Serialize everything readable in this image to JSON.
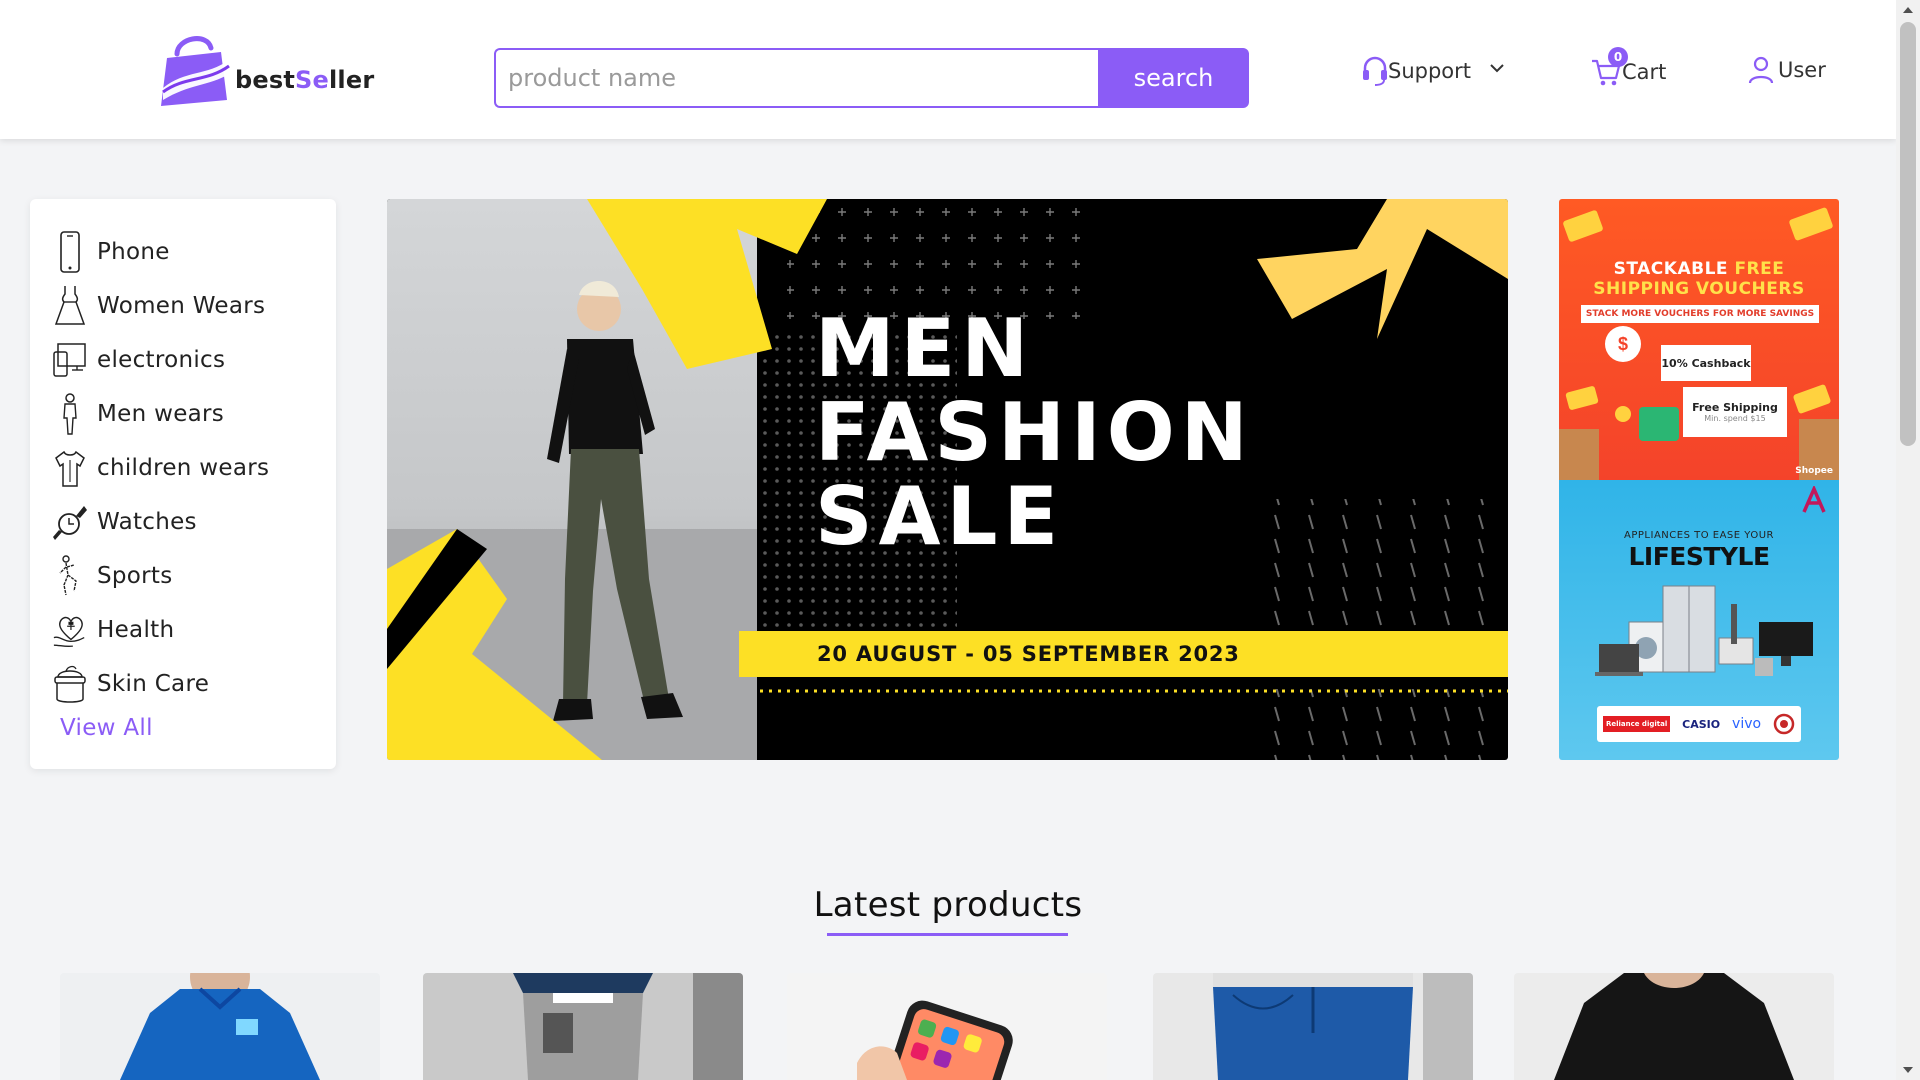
{
  "header": {
    "logo_text_prefix": "best",
    "logo_text_accent": "Se",
    "logo_text_suffix": "ller",
    "search": {
      "placeholder": "product name",
      "button_label": "search"
    },
    "nav": {
      "support_label": "Support",
      "cart_label": "Cart",
      "cart_count": "0",
      "user_label": "User"
    }
  },
  "sidebar": {
    "categories": [
      {
        "label": "Phone",
        "icon": "phone-icon"
      },
      {
        "label": "Women Wears",
        "icon": "dress-icon"
      },
      {
        "label": "electronics",
        "icon": "electronics-icon"
      },
      {
        "label": "Men wears",
        "icon": "man-icon"
      },
      {
        "label": "children wears",
        "icon": "shirt-icon"
      },
      {
        "label": "Watches",
        "icon": "watch-icon"
      },
      {
        "label": "Sports",
        "icon": "sports-icon"
      },
      {
        "label": "Health",
        "icon": "health-icon"
      },
      {
        "label": "Skin Care",
        "icon": "cream-jar-icon"
      }
    ],
    "view_all_label": "View All"
  },
  "hero": {
    "title_line1": "MEN",
    "title_line2": "FASHION",
    "title_line3": "SALE",
    "date_text": "20 AUGUST - 05 SEPTEMBER 2023"
  },
  "ads": {
    "top": {
      "title_line1_a": "STACKABLE ",
      "title_line1_b": "FREE",
      "title_line2": "SHIPPING VOUCHERS",
      "subtitle": "STACK MORE VOUCHERS FOR MORE SAVINGS",
      "card1": "10% Cashback",
      "card2": "Free Shipping",
      "card2_sub": "Min. spend $15",
      "brand": "Shopee"
    },
    "bottom": {
      "subtitle": "APPLIANCES TO EASE YOUR",
      "title": "LIFESTYLE",
      "logo1": "Reliance digital",
      "logo2": "CASIO",
      "logo3": "vivo"
    }
  },
  "latest": {
    "title": "Latest products",
    "products": [
      {
        "name": "blue polo shirt"
      },
      {
        "name": "grey cargo pants"
      },
      {
        "name": "smartphone"
      },
      {
        "name": "blue jeans"
      },
      {
        "name": "black t-shirt"
      }
    ]
  },
  "colors": {
    "accent": "#8b5cf6",
    "banner_yellow": "#fde025",
    "page_bg": "#f3f4f6"
  }
}
